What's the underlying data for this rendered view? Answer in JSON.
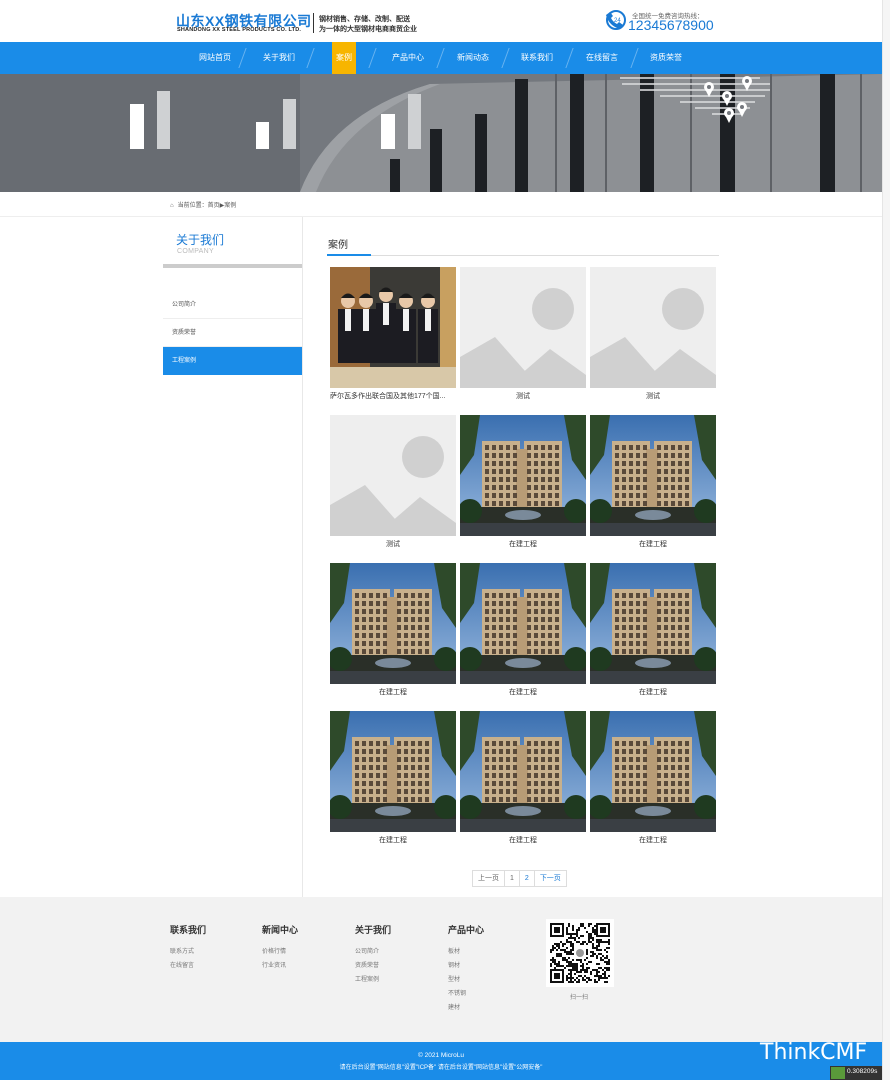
{
  "header": {
    "company_cn": "山东XX钢铁有限公司",
    "company_en": "SHANDONG XX STEEL PRODUCTS CO. LTD.",
    "slogan_line1": "钢材销售、存储、改制、配送",
    "slogan_line2": "为一体的大型钢材电商商贸企业",
    "hotline_label": "全国统一免费咨询热线：",
    "hotline_number": "12345678900",
    "phone_icon_badge": "24"
  },
  "nav": {
    "items": [
      {
        "label": "网站首页",
        "active": false
      },
      {
        "label": "关于我们",
        "active": false
      },
      {
        "label": "案例",
        "active": true
      },
      {
        "label": "产品中心",
        "active": false
      },
      {
        "label": "新闻动态",
        "active": false
      },
      {
        "label": "联系我们",
        "active": false
      },
      {
        "label": "在线留言",
        "active": false
      },
      {
        "label": "资质荣誉",
        "active": false
      }
    ],
    "accent": "#1a8ce8",
    "active_color": "#f7b500"
  },
  "breadcrumb": {
    "prefix": "当前位置：",
    "home": "首页",
    "separator": "▶",
    "current": "案例"
  },
  "sidebar": {
    "title": "关于我们",
    "subtitle": "COMPANY",
    "items": [
      {
        "label": "公司简介",
        "active": false
      },
      {
        "label": "资质荣誉",
        "active": false
      },
      {
        "label": "工程案例",
        "active": true
      }
    ]
  },
  "main": {
    "title": "案例",
    "cards": [
      {
        "caption": "萨尔瓦多作出联合国及其他177个国...",
        "image": "team-photo"
      },
      {
        "caption": "测试",
        "image": "placeholder"
      },
      {
        "caption": "测试",
        "image": "placeholder"
      },
      {
        "caption": "测试",
        "image": "placeholder"
      },
      {
        "caption": "在建工程",
        "image": "building"
      },
      {
        "caption": "在建工程",
        "image": "building"
      },
      {
        "caption": "在建工程",
        "image": "building"
      },
      {
        "caption": "在建工程",
        "image": "building"
      },
      {
        "caption": "在建工程",
        "image": "building"
      },
      {
        "caption": "在建工程",
        "image": "building"
      },
      {
        "caption": "在建工程",
        "image": "building"
      },
      {
        "caption": "在建工程",
        "image": "building"
      }
    ]
  },
  "pagination": {
    "prev": "上一页",
    "pages": [
      "1",
      "2"
    ],
    "current": "2",
    "next": "下一页"
  },
  "footer": {
    "columns": [
      {
        "title": "联系我们",
        "links": [
          "联系方式",
          "在线留言"
        ]
      },
      {
        "title": "新闻中心",
        "links": [
          "价格行情",
          "行业资讯"
        ]
      },
      {
        "title": "关于我们",
        "links": [
          "公司简介",
          "资质荣誉",
          "工程案例"
        ]
      },
      {
        "title": "产品中心",
        "links": [
          "板材",
          "钢材",
          "型材",
          "不锈钢",
          "建材"
        ]
      }
    ],
    "qr_caption": "扫一扫",
    "copyright": "© 2021 MicroLu",
    "icp_note": "请在后台设置\"网站信息\"设置\"ICP备\" 请在后台设置\"网站信息\"设置\"公网安备\""
  },
  "debug": {
    "brand": "ThinkCMF",
    "timer": "0.308209s"
  }
}
